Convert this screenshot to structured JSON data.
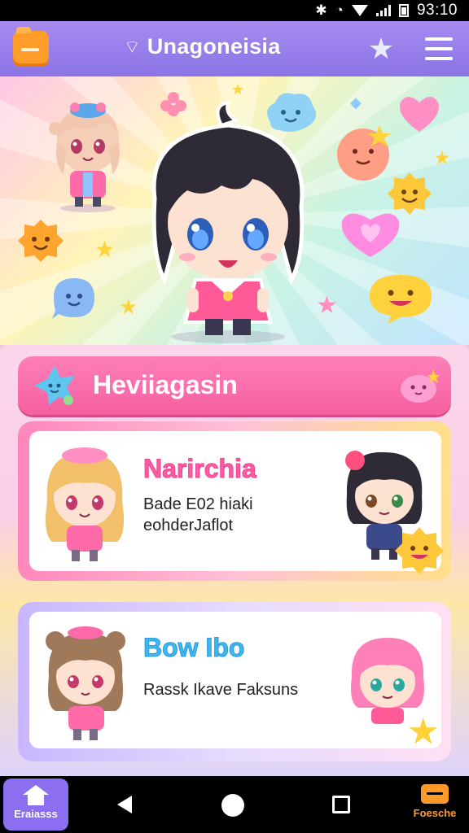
{
  "status_bar": {
    "time": "93:10"
  },
  "app_bar": {
    "title": "Unagoneisia"
  },
  "hero": {},
  "section": {
    "title": "Heviiagasin",
    "cards": [
      {
        "title": "Narirchia",
        "line1": "Bade E02 hiaki",
        "line2": "eohderJaflot"
      },
      {
        "title": "Bow Ibo",
        "line1": "Rassk Ikave Faksuns"
      }
    ]
  },
  "nav": {
    "home_label": "Eraiasss",
    "feature_label": "Foesche"
  },
  "colors": {
    "accent_purple": "#8c74e6",
    "accent_pink": "#f4609f",
    "accent_orange": "#ff9a2a"
  }
}
